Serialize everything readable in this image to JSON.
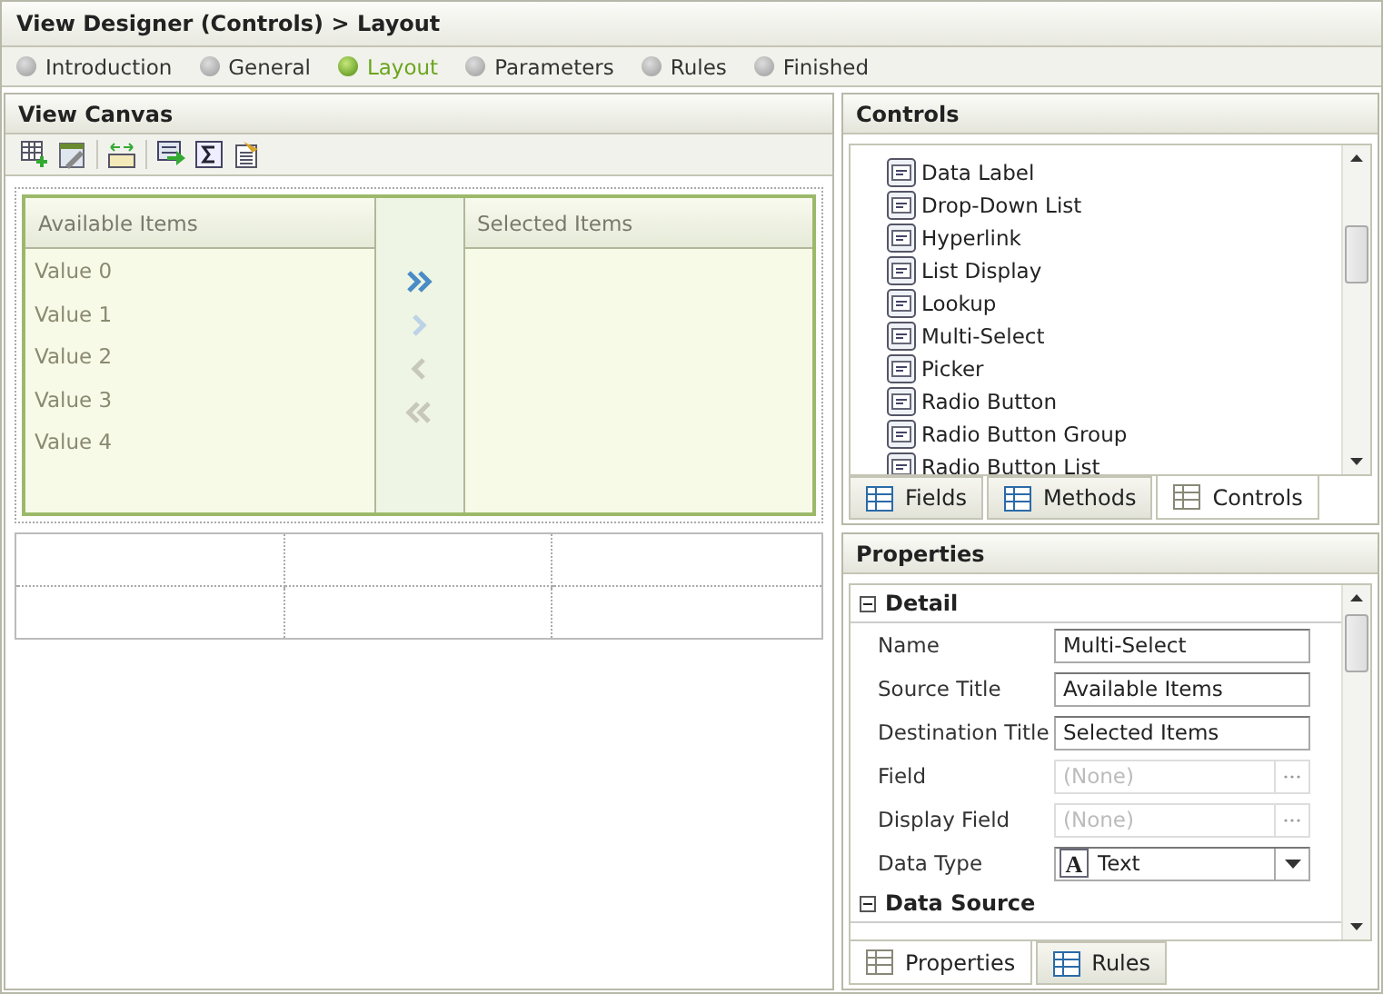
{
  "window": {
    "title": "View Designer (Controls) > Layout"
  },
  "steps": [
    {
      "label": "Introduction",
      "selected": false
    },
    {
      "label": "General",
      "selected": false
    },
    {
      "label": "Layout",
      "selected": true
    },
    {
      "label": "Parameters",
      "selected": false
    },
    {
      "label": "Rules",
      "selected": false
    },
    {
      "label": "Finished",
      "selected": false
    }
  ],
  "canvas": {
    "title": "View Canvas",
    "multi_select": {
      "source_title": "Available Items",
      "destination_title": "Selected Items",
      "source_items": [
        "Value 0",
        "Value 1",
        "Value 2",
        "Value 3",
        "Value 4"
      ],
      "transfer_buttons": [
        {
          "kind": "add_all",
          "disabled": false
        },
        {
          "kind": "add",
          "disabled": true
        },
        {
          "kind": "remove",
          "disabled": true
        },
        {
          "kind": "remove_all",
          "disabled": true
        }
      ]
    }
  },
  "controls": {
    "title": "Controls",
    "items": [
      "Data Label",
      "Drop-Down List",
      "Hyperlink",
      "List Display",
      "Lookup",
      "Multi-Select",
      "Picker",
      "Radio Button",
      "Radio Button Group",
      "Radio Button List"
    ],
    "tabs": [
      {
        "label": "Fields",
        "selected": false
      },
      {
        "label": "Methods",
        "selected": false
      },
      {
        "label": "Controls",
        "selected": true
      }
    ]
  },
  "properties": {
    "title": "Properties",
    "sections": [
      {
        "title": "Detail",
        "expanded": true,
        "rows": [
          {
            "label": "Name",
            "kind": "text",
            "value": "Multi-Select",
            "disabled": false
          },
          {
            "label": "Source Title",
            "kind": "text",
            "value": "Available Items",
            "disabled": false
          },
          {
            "label": "Destination Title",
            "kind": "text",
            "value": "Selected Items",
            "disabled": false
          },
          {
            "label": "Field",
            "kind": "picker",
            "placeholder": "(None)",
            "disabled": true
          },
          {
            "label": "Display Field",
            "kind": "picker",
            "placeholder": "(None)",
            "disabled": true
          },
          {
            "label": "Data Type",
            "kind": "dropdown",
            "icon_letter": "A",
            "value": "Text",
            "disabled": false
          }
        ]
      },
      {
        "title": "Data Source",
        "expanded": true
      }
    ],
    "tabs": [
      {
        "label": "Properties",
        "selected": true
      },
      {
        "label": "Rules",
        "selected": false
      }
    ]
  }
}
